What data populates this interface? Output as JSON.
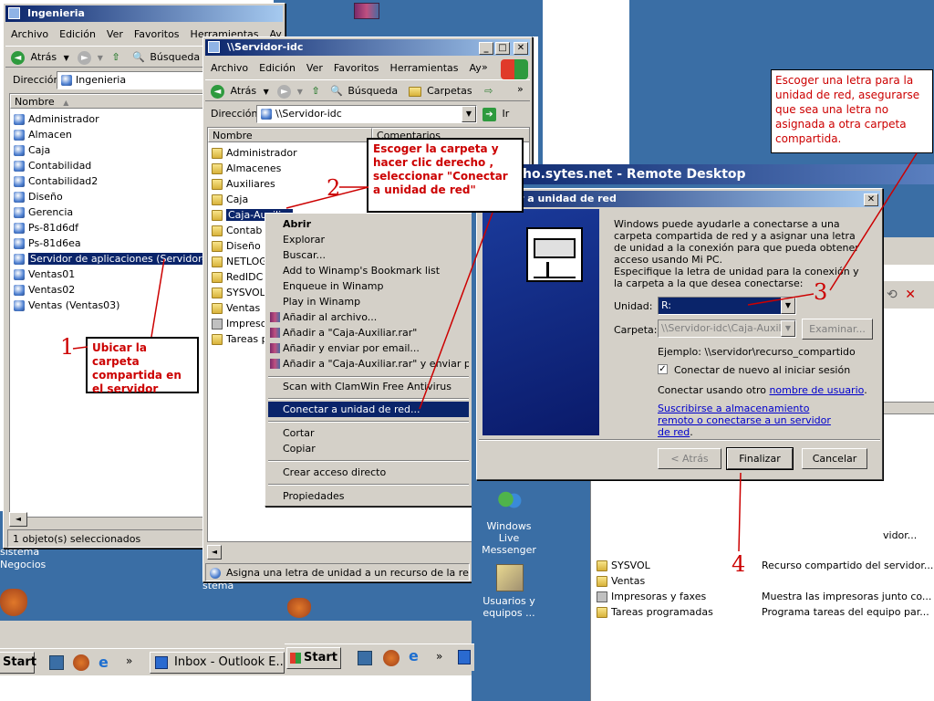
{
  "colors": {
    "desktop": "#3a6ea5",
    "title_active": "#0a246a",
    "annotation": "#cc0000",
    "selection": "#0a246a"
  },
  "win1": {
    "title": "Ingenieria",
    "menu": [
      "Archivo",
      "Edición",
      "Ver",
      "Favoritos",
      "Herramientas",
      "Ay"
    ],
    "back": "Atrás",
    "search": "Búsqueda",
    "address_label": "Dirección",
    "address": "Ingenieria",
    "col_name": "Nombre",
    "items": [
      "Administrador",
      "Almacen",
      "Caja",
      "Contabilidad",
      "Contabilidad2",
      "Diseño",
      "Gerencia",
      "Ps-81d6df",
      "Ps-81d6ea",
      "Servidor de aplicaciones (Servidor-idc)",
      "Ventas01",
      "Ventas02",
      "Ventas (Ventas03)"
    ],
    "status": "1 objeto(s) seleccionados"
  },
  "win2": {
    "title": "\\\\Servidor-idc",
    "menu": [
      "Archivo",
      "Edición",
      "Ver",
      "Favoritos",
      "Herramientas",
      "Ay"
    ],
    "back": "Atrás",
    "search": "Búsqueda",
    "folders": "Carpetas",
    "address_label": "Dirección",
    "address": "\\\\Servidor-idc",
    "go": "Ir",
    "col_name": "Nombre",
    "col_comments": "Comentarios",
    "items": [
      "Administrador",
      "Almacenes",
      "Auxiliares",
      "Caja",
      "Caja-Auxiliar",
      "Contab",
      "Diseño",
      "NETLOGON",
      "RedIDC",
      "SYSVOL",
      "Ventas",
      "Impresoras y faxes",
      "Tareas programadas"
    ],
    "status": "Asigna una letra de unidad a un recurso de la red."
  },
  "context_menu": {
    "items": [
      "Abrir",
      "Explorar",
      "Buscar...",
      "Add to Winamp's Bookmark list",
      "Enqueue in Winamp",
      "Play in Winamp",
      "Añadir al archivo...",
      "Añadir a \"Caja-Auxiliar.rar\"",
      "Añadir y enviar por email...",
      "Añadir a \"Caja-Auxiliar.rar\" y enviar por email",
      "Scan with ClamWin Free Antivirus",
      "Conectar a unidad de red...",
      "Cortar",
      "Copiar",
      "Crear acceso directo",
      "Propiedades"
    ]
  },
  "remote_desktop": {
    "title": "ho.sytes.net - Remote Desktop",
    "desktop_icons": [
      "Windows Live Messenger",
      "Usuarios y equipos ..."
    ],
    "list": [
      {
        "name": "SYSVOL",
        "comment": "Recurso compartido del servidor..."
      },
      {
        "name": "Ventas",
        "comment": ""
      },
      {
        "name": "Impresoras y faxes",
        "comment": "Muestra las impresoras junto co..."
      },
      {
        "name": "Tareas programadas",
        "comment": "Programa tareas del equipo par..."
      }
    ],
    "partial_comment": "vidor..."
  },
  "dialog": {
    "title": "r a unidad de red",
    "text1": "Windows puede ayudarle a conectarse a una carpeta compartida de red y a asignar una letra de unidad a la conexión para que pueda obtener acceso usando Mi PC.",
    "text2": "Especifique la letra de unidad para la conexión y la carpeta a la que desea conectarse:",
    "unidad_label": "Unidad:",
    "unidad_value": "R:",
    "carpeta_label": "Carpeta:",
    "carpeta_value": "\\\\Servidor-idc\\Caja-Auxilia",
    "browse": "Examinar...",
    "example": "Ejemplo: \\\\servidor\\recurso_compartido",
    "reconnect": "Conectar de nuevo al iniciar sesión",
    "other_user_prefix": "Conectar usando otro ",
    "other_user_link": "nombre de usuario",
    "other_user_suffix": ".",
    "subscribe_link": "Suscribirse a almacenamiento remoto o conectarse a un servidor de red",
    "subscribe_suffix": ".",
    "back": "< Atrás",
    "finish": "Finalizar",
    "cancel": "Cancelar"
  },
  "annotations": {
    "n1": "1",
    "t1": "Ubicar la carpeta compartida en el servidor",
    "n2": "2",
    "t2": "Escoger la carpeta y hacer clic derecho , seleccionar \"Conectar a unidad de red\"",
    "n3": "3",
    "t3": "Escoger una letra para la unidad de red, asegurarse que sea una letra no asignada a otra carpeta compartida.",
    "n4": "4"
  },
  "desktop_left": {
    "label1": "sistema",
    "label2": "Negocios",
    "label3": "stema"
  },
  "taskbar": {
    "start": "Start",
    "inbox": "Inbox - Outlook E..."
  }
}
